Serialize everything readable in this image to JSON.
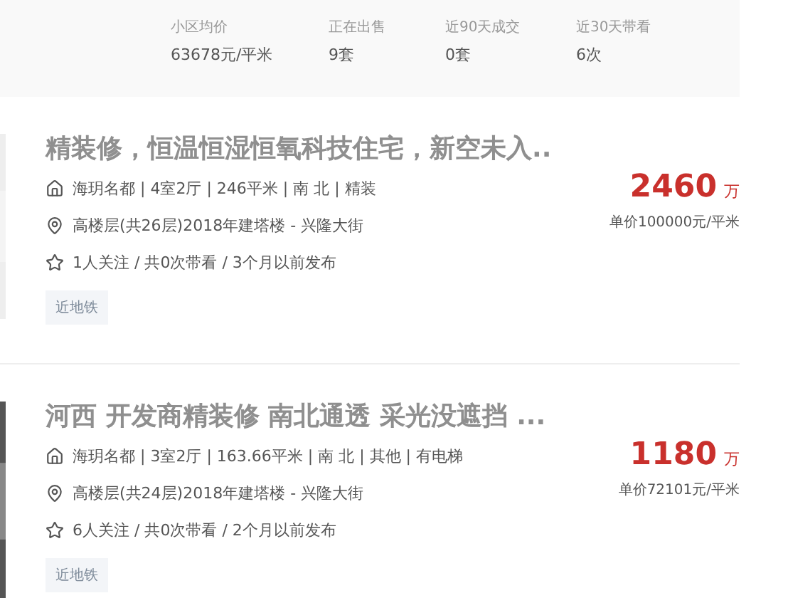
{
  "community_stats": [
    {
      "label": "小区均价",
      "value": "63678元/平米"
    },
    {
      "label": "正在出售",
      "value": "9套"
    },
    {
      "label": "近90天成交",
      "value": "0套"
    },
    {
      "label": "近30天带看",
      "value": "6次"
    }
  ],
  "listings": [
    {
      "title": "精装修，恒温恒湿恒氧科技住宅，新空未入..",
      "info": "海玥名都 | 4室2厅 | 246平米 | 南 北 | 精装",
      "location": "高楼层(共26层)2018年建塔楼 - 兴隆大街",
      "followers": "1人关注 / 共0次带看 / 3个月以前发布",
      "tags": [
        "近地铁"
      ],
      "price": "2460",
      "price_unit": "万",
      "unit_price": "单价100000元/平米"
    },
    {
      "title": "河西 开发商精装修 南北通透 采光没遮挡 ...",
      "info": "海玥名都 | 3室2厅 | 163.66平米 | 南 北 | 其他 | 有电梯",
      "location": "高楼层(共24层)2018年建塔楼 - 兴隆大街",
      "followers": "6人关注 / 共0次带看 / 2个月以前发布",
      "tags": [
        "近地铁"
      ],
      "price": "1180",
      "price_unit": "万",
      "unit_price": "单价72101元/平米"
    }
  ]
}
